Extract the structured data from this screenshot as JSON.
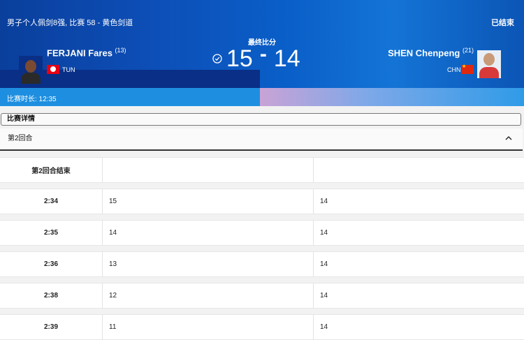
{
  "header": {
    "event_title": "男子个人佩剑8强, 比赛 58 - 黄色剑道",
    "status": "已结束",
    "final_score_label": "最终比分",
    "score_left": "15",
    "score_separator": "-",
    "score_right": "14",
    "duration_label": "比赛时长: 12:35"
  },
  "player_left": {
    "name": "FERJANI Fares",
    "seed": "(13)",
    "noc": "TUN",
    "flag_color": "#e70013"
  },
  "player_right": {
    "name": "SHEN Chenpeng",
    "seed": "(21)",
    "noc": "CHN",
    "flag_color": "#de2910"
  },
  "details": {
    "title": "比赛详情",
    "round_label": "第2回合",
    "round_end_label": "第2回合结束",
    "rows": [
      {
        "time": "2:34",
        "left": "15",
        "right": "14"
      },
      {
        "time": "2:35",
        "left": "14",
        "right": "14"
      },
      {
        "time": "2:36",
        "left": "13",
        "right": "14"
      },
      {
        "time": "2:38",
        "left": "12",
        "right": "14"
      },
      {
        "time": "2:39",
        "left": "11",
        "right": "14"
      }
    ]
  }
}
